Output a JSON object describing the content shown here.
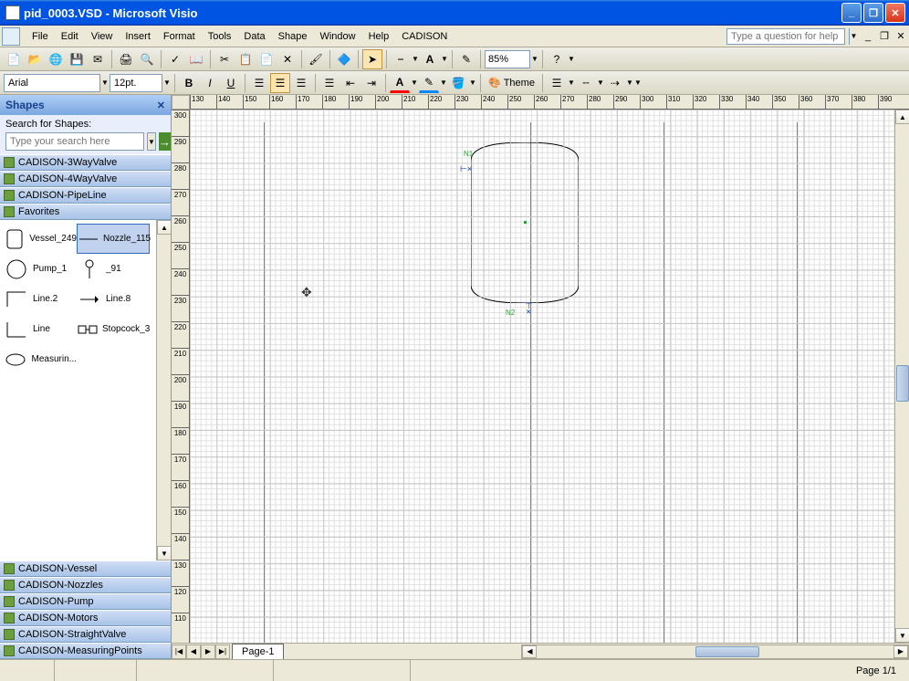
{
  "title": "pid_0003.VSD - Microsoft Visio",
  "menus": [
    "File",
    "Edit",
    "View",
    "Insert",
    "Format",
    "Tools",
    "Data",
    "Shape",
    "Window",
    "Help",
    "CADISON"
  ],
  "help_placeholder": "Type a question for help",
  "zoom": "85%",
  "font": {
    "name": "Arial",
    "size": "12pt."
  },
  "theme_label": "Theme",
  "shapes": {
    "title": "Shapes",
    "search_label": "Search for Shapes:",
    "search_placeholder": "Type your search here",
    "stencils_top": [
      "CADISON-3WayValve",
      "CADISON-4WayValve",
      "CADISON-PipeLine",
      "Favorites"
    ],
    "stencils_bottom": [
      "CADISON-Vessel",
      "CADISON-Nozzles",
      "CADISON-Pump",
      "CADISON-Motors",
      "CADISON-StraightValve",
      "CADISON-MeasuringPoints"
    ],
    "favorites": [
      {
        "name": "Vessel_249"
      },
      {
        "name": "Nozzle_115"
      },
      {
        "name": "Pump_1"
      },
      {
        "name": "_91"
      },
      {
        "name": "Line.2"
      },
      {
        "name": "Line.8"
      },
      {
        "name": "Line"
      },
      {
        "name": "Stopcock_3"
      },
      {
        "name": "Measurin..."
      }
    ]
  },
  "ruler_h": [
    "130",
    "140",
    "150",
    "160",
    "170",
    "180",
    "190",
    "200",
    "210",
    "220",
    "230",
    "240",
    "250",
    "260",
    "270",
    "280",
    "290",
    "300",
    "310",
    "320",
    "330",
    "340",
    "350",
    "360",
    "370",
    "380",
    "390"
  ],
  "ruler_v": [
    "300",
    "290",
    "280",
    "270",
    "260",
    "250",
    "240",
    "230",
    "220",
    "210",
    "200",
    "190",
    "180",
    "170",
    "160",
    "150",
    "140",
    "130",
    "120",
    "110"
  ],
  "canvas": {
    "nozzle1": "N1",
    "nozzle2": "N2"
  },
  "page_tab": "Page-1",
  "status_page": "Page 1/1"
}
